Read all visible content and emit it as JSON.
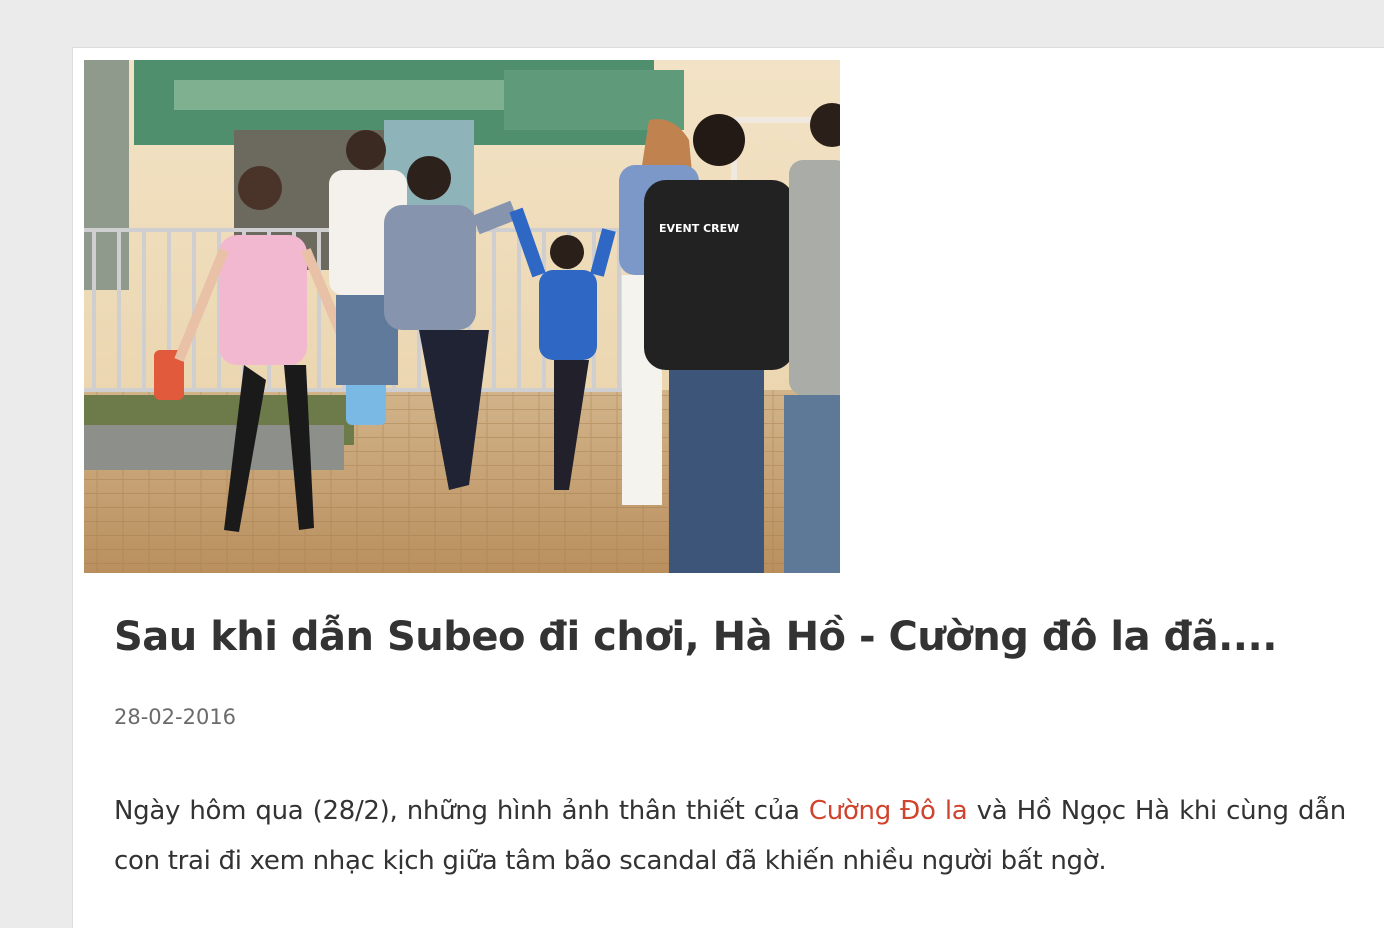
{
  "article": {
    "image_alt": "Photo of a family walking in a park plaza",
    "image_text": "EVENT CREW",
    "title": "Sau khi dẫn Subeo đi chơi, Hà Hồ - Cường đô la đã....",
    "date": "28-02-2016",
    "summary": {
      "before_link": "Ngày hôm qua (28/2), những hình ảnh thân thiết của ",
      "link_text": "Cường Đô la",
      "after_link": " và Hồ Ngọc Hà khi cùng dẫn con trai đi xem nhạc kịch giữa tâm bão scandal đã khiến nhiều người bất ngờ."
    }
  },
  "colors": {
    "background": "#ebebeb",
    "card": "#ffffff",
    "link": "#d0432c",
    "text": "#333333",
    "date": "#6b6b6b"
  }
}
